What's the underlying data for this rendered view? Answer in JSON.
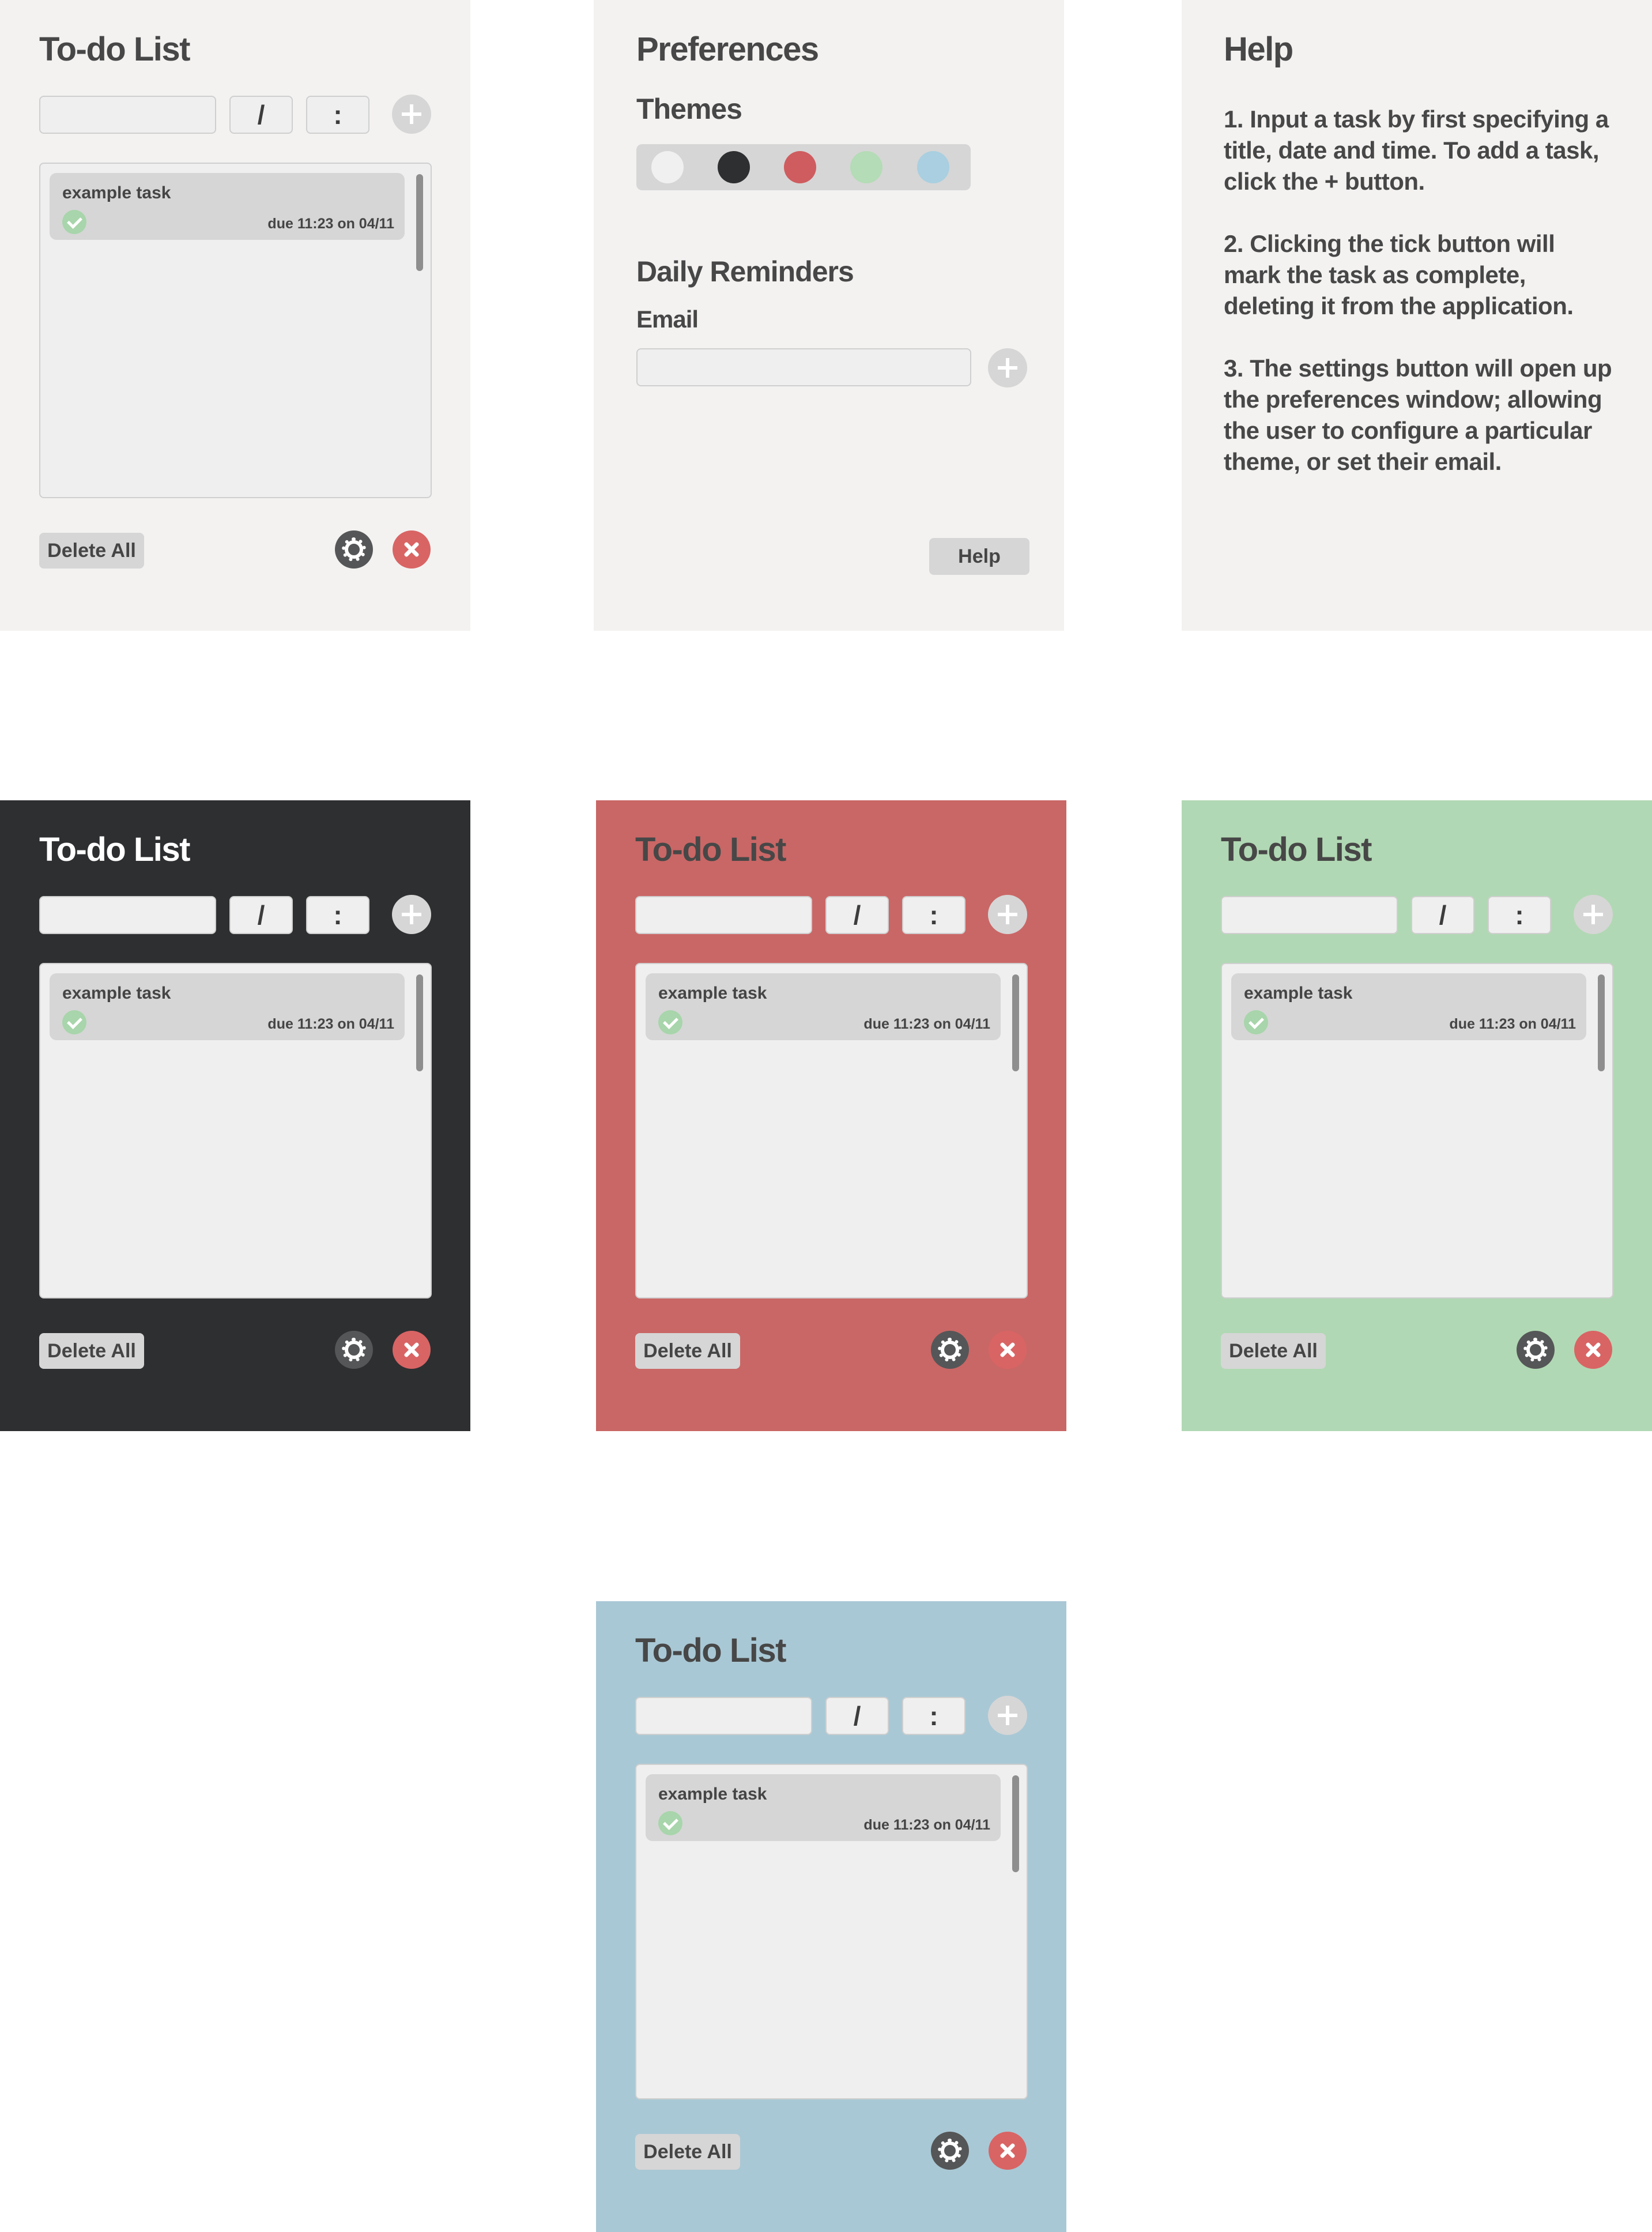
{
  "todo": {
    "title": "To-do List",
    "date_separator": "/",
    "time_separator": ":",
    "task": {
      "name": "example task",
      "due": "due 11:23 on 04/11"
    },
    "delete_all_label": "Delete All"
  },
  "themes": [
    {
      "name": "light",
      "color": "#f3f2f1"
    },
    {
      "name": "dark",
      "color": "#2e2f31"
    },
    {
      "name": "red",
      "color": "#c96766"
    },
    {
      "name": "green",
      "color": "#b1d8b4"
    },
    {
      "name": "blue",
      "color": "#a9c8d5"
    }
  ],
  "preferences": {
    "title": "Preferences",
    "themes_label": "Themes",
    "swatches": [
      "#f0f0f0",
      "#2e2f31",
      "#cf5c5f",
      "#b4dcb6",
      "#a9cfe0"
    ],
    "daily_reminders_label": "Daily Reminders",
    "email_label": "Email",
    "email_value": "",
    "help_label": "Help"
  },
  "help": {
    "title": "Help",
    "steps": [
      "1. Input a task by first specifying a title, date and time.  To add a task, click the + button.",
      "2. Clicking the tick button will mark the task as complete, deleting it from the application.",
      "3. The settings button will open up the preferences window; allowing the user to configure a particular theme, or set their email."
    ]
  }
}
